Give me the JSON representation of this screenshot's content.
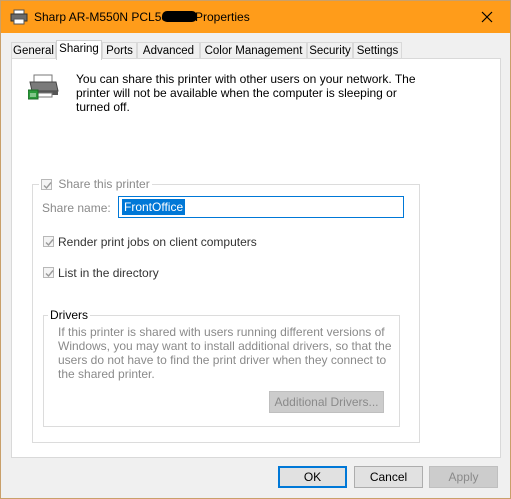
{
  "window": {
    "title_prefix": "Sharp AR-M550N PCL5e",
    "title_suffix": "Properties"
  },
  "tabs": [
    {
      "label": "General"
    },
    {
      "label": "Sharing"
    },
    {
      "label": "Ports"
    },
    {
      "label": "Advanced"
    },
    {
      "label": "Color Management"
    },
    {
      "label": "Security"
    },
    {
      "label": "Settings"
    }
  ],
  "sharing": {
    "intro": "You can share this printer with other users on your network. The printer will not be available when the computer is sleeping or turned off.",
    "share_checkbox_label": "Share this printer",
    "share_name_label": "Share name:",
    "share_name_value": "FrontOffice",
    "render_jobs_label": "Render print jobs on client computers",
    "list_directory_label": "List in the directory",
    "drivers_legend": "Drivers",
    "drivers_text": "If this printer is shared with users running different versions of Windows, you may want to install additional drivers, so that the users do not have to find the print driver when they connect to the shared printer.",
    "additional_drivers_button": "Additional Drivers..."
  },
  "buttons": {
    "ok": "OK",
    "cancel": "Cancel",
    "apply": "Apply"
  },
  "colors": {
    "titlebar": "#ff9c1a",
    "accent": "#0078d7"
  }
}
